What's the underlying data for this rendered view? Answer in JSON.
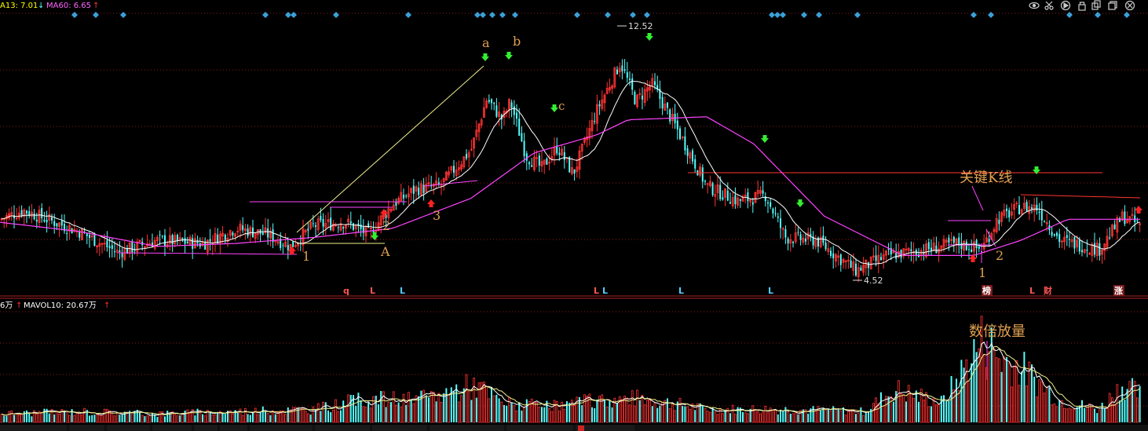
{
  "header": {
    "ma13_label": "A13: 7.01",
    "ma13_arrow": "↓",
    "ma60_label": "MA60: 6.65",
    "ma60_arrow": "↑",
    "ma13_color": "#ffff00",
    "ma60_color": "#ff66ff"
  },
  "toolbar": {
    "icons": [
      "eye-icon",
      "scissors-icon",
      "settings-icon",
      "lock-icon",
      "copy-icon",
      "restore-icon",
      "close-icon"
    ]
  },
  "volume_header": {
    "vol_label": "6万",
    "vol_arrow": "↑",
    "mavol_label": "MAVOL10: 20.67万",
    "mavol_arrow": "↑"
  },
  "price_labels": {
    "high": "12.52",
    "low": "4.52"
  },
  "annotations": {
    "a": "a",
    "b": "b",
    "c": "c",
    "n1": "1",
    "n2": "2",
    "n3": "3",
    "A": "A",
    "key_kline": "关键K线",
    "right_1": "1",
    "right_2": "2",
    "volume_note": "数倍放量"
  },
  "event_markers": [
    {
      "text": "q",
      "color": "#ff5555"
    },
    {
      "text": "L",
      "color": "#ff5555"
    },
    {
      "text": "L",
      "color": "#55ccff"
    },
    {
      "text": "L",
      "color": "#ff5555"
    },
    {
      "text": "L",
      "color": "#55ccff"
    },
    {
      "text": "L",
      "color": "#55ccff"
    },
    {
      "text": "L",
      "color": "#55ccff"
    },
    {
      "text": "榜",
      "color": "#ffffff"
    },
    {
      "text": "L",
      "color": "#ff5555"
    },
    {
      "text": "财",
      "color": "#ff5555"
    },
    {
      "text": "涨",
      "color": "#ffffff"
    }
  ],
  "colors": {
    "up": "#ff3333",
    "down": "#55ffff",
    "ma13": "#ffffff",
    "ma60": "#ff44ff",
    "annotation": "#e0a050",
    "grid": "#8b1a1a",
    "diamond": "#3aa0d8"
  },
  "chart_data": {
    "type": "candlestick",
    "price_series": [
      {
        "x": 0,
        "close": 6.3
      },
      {
        "x": 30,
        "close": 6.6
      },
      {
        "x": 60,
        "close": 6.3
      },
      {
        "x": 100,
        "close": 5.9
      },
      {
        "x": 150,
        "close": 5.2
      },
      {
        "x": 200,
        "close": 5.6
      },
      {
        "x": 260,
        "close": 5.5
      },
      {
        "x": 300,
        "close": 6.0
      },
      {
        "x": 340,
        "close": 5.8
      },
      {
        "x": 370,
        "close": 5.4
      },
      {
        "x": 400,
        "close": 6.1
      },
      {
        "x": 440,
        "close": 6.2
      },
      {
        "x": 470,
        "close": 5.8
      },
      {
        "x": 500,
        "close": 6.8
      },
      {
        "x": 530,
        "close": 7.3
      },
      {
        "x": 560,
        "close": 7.4
      },
      {
        "x": 600,
        "close": 8.6
      },
      {
        "x": 620,
        "close": 10.3
      },
      {
        "x": 640,
        "close": 9.6
      },
      {
        "x": 650,
        "close": 10.2
      },
      {
        "x": 670,
        "close": 8.4
      },
      {
        "x": 690,
        "close": 8.0
      },
      {
        "x": 710,
        "close": 8.7
      },
      {
        "x": 730,
        "close": 7.8
      },
      {
        "x": 760,
        "close": 9.9
      },
      {
        "x": 790,
        "close": 11.5
      },
      {
        "x": 810,
        "close": 10.2
      },
      {
        "x": 830,
        "close": 10.8
      },
      {
        "x": 860,
        "close": 9.4
      },
      {
        "x": 900,
        "close": 7.4
      },
      {
        "x": 940,
        "close": 6.9
      },
      {
        "x": 975,
        "close": 7.1
      },
      {
        "x": 1000,
        "close": 5.7
      },
      {
        "x": 1040,
        "close": 5.6
      },
      {
        "x": 1090,
        "close": 4.6
      },
      {
        "x": 1130,
        "close": 5.1
      },
      {
        "x": 1180,
        "close": 5.3
      },
      {
        "x": 1220,
        "close": 5.5
      },
      {
        "x": 1250,
        "close": 5.3
      },
      {
        "x": 1270,
        "close": 6.3
      },
      {
        "x": 1300,
        "close": 6.7
      },
      {
        "x": 1320,
        "close": 6.7
      },
      {
        "x": 1350,
        "close": 5.6
      },
      {
        "x": 1400,
        "close": 5.3
      },
      {
        "x": 1430,
        "close": 6.4
      },
      {
        "x": 1452,
        "close": 6.1
      }
    ],
    "ma60": [
      {
        "x": 0,
        "v": 6.2
      },
      {
        "x": 100,
        "v": 5.9
      },
      {
        "x": 200,
        "v": 5.4
      },
      {
        "x": 300,
        "v": 5.5
      },
      {
        "x": 400,
        "v": 5.7
      },
      {
        "x": 500,
        "v": 6.0
      },
      {
        "x": 600,
        "v": 7.0
      },
      {
        "x": 680,
        "v": 8.5
      },
      {
        "x": 760,
        "v": 9.1
      },
      {
        "x": 800,
        "v": 9.6
      },
      {
        "x": 900,
        "v": 9.7
      },
      {
        "x": 960,
        "v": 8.8
      },
      {
        "x": 1050,
        "v": 6.4
      },
      {
        "x": 1150,
        "v": 5.1
      },
      {
        "x": 1240,
        "v": 5.1
      },
      {
        "x": 1300,
        "v": 5.6
      },
      {
        "x": 1360,
        "v": 6.3
      },
      {
        "x": 1452,
        "v": 6.3
      }
    ],
    "volume": [
      {
        "x": 0,
        "v": 8
      },
      {
        "x": 100,
        "v": 10
      },
      {
        "x": 200,
        "v": 8
      },
      {
        "x": 300,
        "v": 10
      },
      {
        "x": 400,
        "v": 12
      },
      {
        "x": 470,
        "v": 22
      },
      {
        "x": 530,
        "v": 20
      },
      {
        "x": 605,
        "v": 35
      },
      {
        "x": 640,
        "v": 18
      },
      {
        "x": 700,
        "v": 14
      },
      {
        "x": 760,
        "v": 20
      },
      {
        "x": 820,
        "v": 22
      },
      {
        "x": 900,
        "v": 12
      },
      {
        "x": 1000,
        "v": 12
      },
      {
        "x": 1100,
        "v": 10
      },
      {
        "x": 1140,
        "v": 30
      },
      {
        "x": 1200,
        "v": 18
      },
      {
        "x": 1255,
        "v": 80
      },
      {
        "x": 1270,
        "v": 60
      },
      {
        "x": 1300,
        "v": 50
      },
      {
        "x": 1350,
        "v": 20
      },
      {
        "x": 1400,
        "v": 12
      },
      {
        "x": 1430,
        "v": 35
      },
      {
        "x": 1452,
        "v": 25
      }
    ],
    "high": 12.52,
    "low": 4.52,
    "ylim": [
      4.2,
      13.0
    ]
  }
}
